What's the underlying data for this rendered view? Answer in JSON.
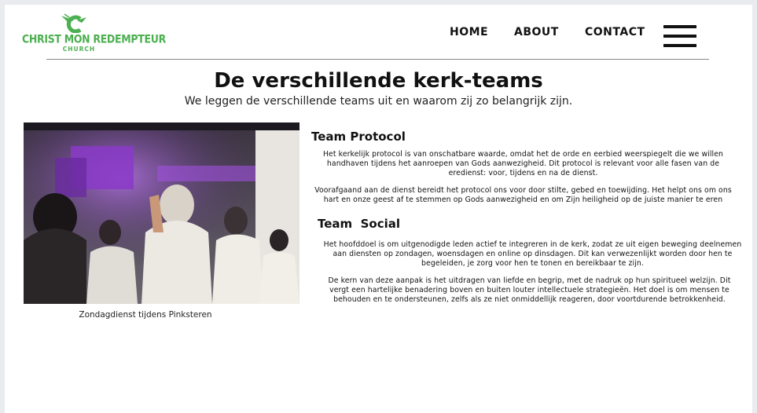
{
  "brand": {
    "name": "CHRIST MON REDEMPTEUR",
    "sub": "CHURCH",
    "color": "#4caf50"
  },
  "nav": {
    "home": "HOME",
    "about": "ABOUT",
    "contact": "CONTACT",
    "menu_icon": "hamburger-menu-icon"
  },
  "header": {
    "title": "De verschillende kerk-teams",
    "subtitle": "We leggen de verschillende teams uit en waarom zij zo belangrijk zijn."
  },
  "photo": {
    "caption": "Zondagdienst tijdens Pinksteren"
  },
  "teams": [
    {
      "heading": "Team Protocol",
      "paragraphs": [
        "Het kerkelijk protocol is van onschatbare waarde, omdat het de orde en eerbied weerspiegelt die we willen handhaven tijdens het aanroepen van Gods aanwezigheid. Dit protocol is relevant voor alle fasen van de eredienst: voor, tijdens en na de dienst.",
        "Voorafgaand aan de dienst bereidt het protocol ons voor door stilte, gebed en toewijding. Het helpt ons om ons hart en onze geest af te stemmen op Gods aanwezigheid en om Zijn heiligheid op de juiste manier te eren"
      ]
    },
    {
      "heading": "Team  Social",
      "paragraphs": [
        "Het hoofddoel is om uitgenodigde leden actief te integreren in de kerk, zodat ze uit eigen beweging deelnemen aan diensten op zondagen, woensdagen en online op dinsdagen. Dit kan verwezenlijkt worden door hen te begeleiden, je zorg voor hen te tonen en bereikbaar te zijn.",
        "De kern van deze aanpak is het uitdragen van liefde en begrip, met de nadruk op hun spiritueel welzijn. Dit vergt een hartelijke benadering boven en buiten louter intellectuele strategieën. Het doel is om mensen te behouden en te ondersteunen, zelfs als ze niet onmiddellijk reageren, door voortdurende betrokkenheid."
      ]
    }
  ]
}
